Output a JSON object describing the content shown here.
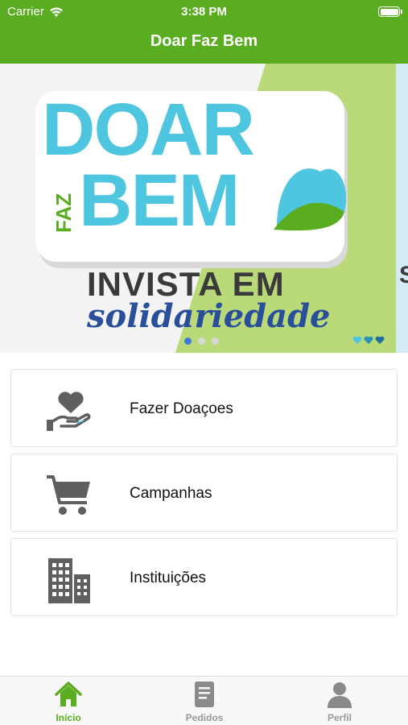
{
  "status_bar": {
    "carrier": "Carrier",
    "time": "3:38 PM"
  },
  "nav": {
    "title": "Doar Faz Bem"
  },
  "banner": {
    "logo_doar": "DOAR",
    "logo_faz": "FAZ",
    "logo_bem": "BEM",
    "tagline_1": "INVISTA EM",
    "tagline_2": "solidariedade",
    "edge_letter": "S",
    "page_count": 3,
    "current_page": 1
  },
  "menu": {
    "items": [
      {
        "label": "Fazer Doaçoes",
        "icon": "donation-hand-heart-icon"
      },
      {
        "label": "Campanhas",
        "icon": "shopping-cart-icon"
      },
      {
        "label": "Instituições",
        "icon": "buildings-icon"
      }
    ]
  },
  "tabbar": {
    "tabs": [
      {
        "label": "Início",
        "icon": "home-icon",
        "active": true
      },
      {
        "label": "Pedidos",
        "icon": "document-icon",
        "active": false
      },
      {
        "label": "Perfil",
        "icon": "person-icon",
        "active": false
      }
    ]
  },
  "colors": {
    "primary": "#5aac21",
    "banner_green": "#bada7a",
    "logo_blue": "#4fc6e0",
    "tagline_blue": "#2a4f9a",
    "icon_gray": "#5f5f5f"
  }
}
